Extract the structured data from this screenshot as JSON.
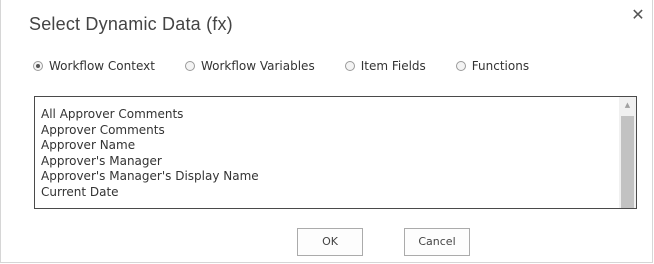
{
  "dialog": {
    "title": "Select Dynamic Data (fx)",
    "close_glyph": "✕"
  },
  "radios": [
    {
      "label": "Workflow Context",
      "checked": true
    },
    {
      "label": "Workflow Variables",
      "checked": false
    },
    {
      "label": "Item Fields",
      "checked": false
    },
    {
      "label": "Functions",
      "checked": false
    }
  ],
  "list": {
    "items": [
      "All Approver Comments",
      "Approver Comments",
      "Approver Name",
      "Approver's Manager",
      "Approver's Manager's Display Name",
      "Current Date"
    ]
  },
  "buttons": {
    "ok": "OK",
    "cancel": "Cancel"
  }
}
